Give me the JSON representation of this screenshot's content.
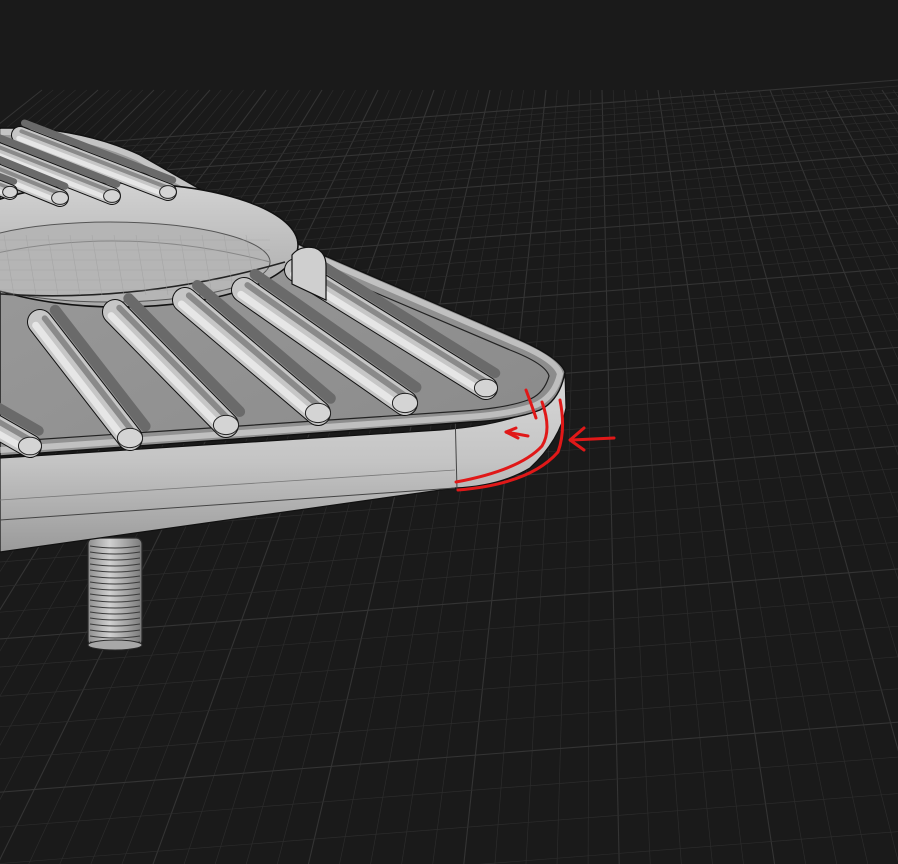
{
  "viewport": {
    "background_color": "#1a1a1a",
    "grid_color": "#2c2c2c",
    "grid_major_color": "#343434"
  },
  "model": {
    "body_color": "#bdbdbd",
    "shadow_color": "#7d7d7d",
    "edge_color": "#111111",
    "highlight_color": "#e2e2e2"
  },
  "annotation": {
    "color": "#e01818"
  }
}
